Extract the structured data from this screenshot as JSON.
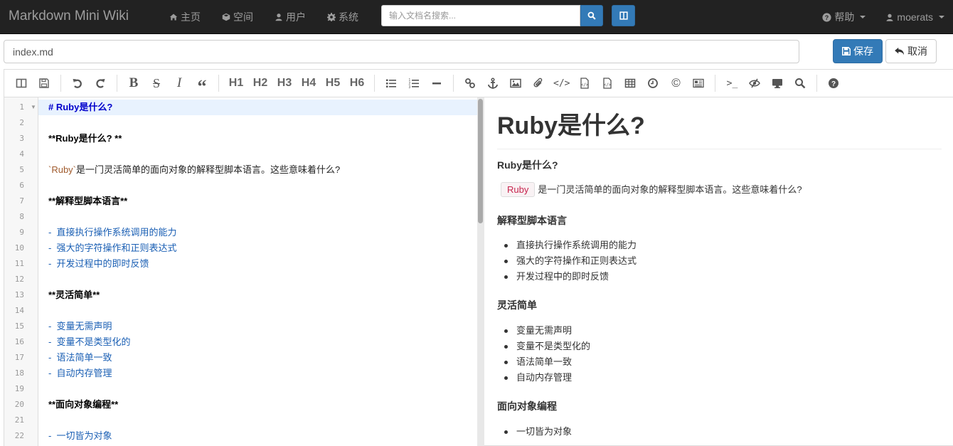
{
  "navbar": {
    "brand": "Markdown Mini Wiki",
    "links": [
      {
        "icon": "home-icon",
        "label": "主页"
      },
      {
        "icon": "cube-icon",
        "label": "空间"
      },
      {
        "icon": "user-icon",
        "label": "用户"
      },
      {
        "icon": "gear-icon",
        "label": "系统"
      }
    ],
    "search_placeholder": "输入文档名搜索...",
    "help_label": "帮助",
    "username": "moerats"
  },
  "filebar": {
    "filename": "index.md",
    "save_label": "保存",
    "cancel_label": "取消"
  },
  "toolbar": {
    "headings": [
      "H1",
      "H2",
      "H3",
      "H4",
      "H5",
      "H6"
    ]
  },
  "editor": {
    "lines": [
      {
        "n": "1",
        "text": "# Ruby是什么?",
        "style": "h1",
        "active": true,
        "fold": true
      },
      {
        "n": "2",
        "text": "",
        "style": "plain"
      },
      {
        "n": "3",
        "text": "**Ruby是什么? **",
        "style": "bold"
      },
      {
        "n": "4",
        "text": "",
        "style": "plain"
      },
      {
        "n": "5",
        "text": "是一门灵活简单的面向对象的解释型脚本语言。这些意味着什么?",
        "code": "`Ruby`",
        "style": "codeline"
      },
      {
        "n": "6",
        "text": "",
        "style": "plain"
      },
      {
        "n": "7",
        "text": "**解释型脚本语言**",
        "style": "bold"
      },
      {
        "n": "8",
        "text": "",
        "style": "plain"
      },
      {
        "n": "9",
        "text": "-  直接执行操作系统调用的能力",
        "style": "list"
      },
      {
        "n": "10",
        "text": "-  强大的字符操作和正则表达式",
        "style": "list"
      },
      {
        "n": "11",
        "text": "-  开发过程中的即时反馈",
        "style": "list"
      },
      {
        "n": "12",
        "text": "",
        "style": "plain"
      },
      {
        "n": "13",
        "text": "**灵活简单**",
        "style": "bold"
      },
      {
        "n": "14",
        "text": "",
        "style": "plain"
      },
      {
        "n": "15",
        "text": "-  变量无需声明",
        "style": "list"
      },
      {
        "n": "16",
        "text": "-  变量不是类型化的",
        "style": "list"
      },
      {
        "n": "17",
        "text": "-  语法简单一致",
        "style": "list"
      },
      {
        "n": "18",
        "text": "-  自动内存管理",
        "style": "list"
      },
      {
        "n": "19",
        "text": "",
        "style": "plain"
      },
      {
        "n": "20",
        "text": "**面向对象编程**",
        "style": "bold"
      },
      {
        "n": "21",
        "text": "",
        "style": "plain"
      },
      {
        "n": "22",
        "text": "-  一切皆为对象",
        "style": "list"
      }
    ]
  },
  "preview": {
    "h1": "Ruby是什么?",
    "sub1": "Ruby是什么?",
    "code_word": "Ruby",
    "intro": "是一门灵活简单的面向对象的解释型脚本语言。这些意味着什么?",
    "sec1": "解释型脚本语言",
    "list1": [
      "直接执行操作系统调用的能力",
      "强大的字符操作和正则表达式",
      "开发过程中的即时反馈"
    ],
    "sec2": "灵活简单",
    "list2": [
      "变量无需声明",
      "变量不是类型化的",
      "语法简单一致",
      "自动内存管理"
    ],
    "sec3": "面向对象编程",
    "list3": [
      "一切皆为对象"
    ]
  }
}
